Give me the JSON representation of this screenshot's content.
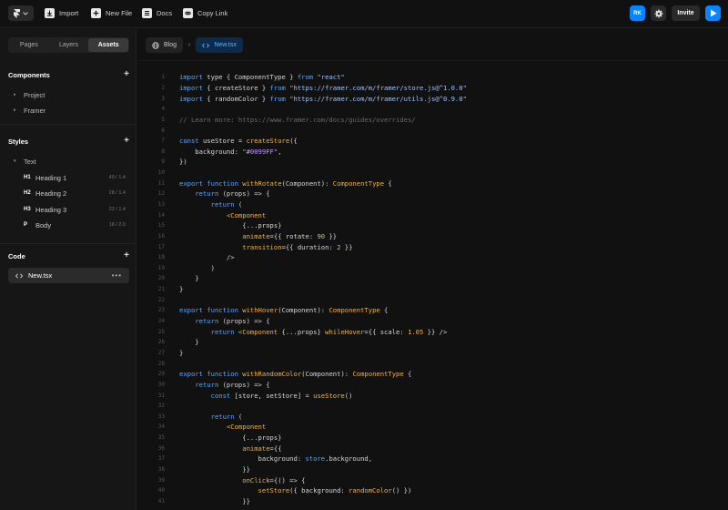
{
  "toolbar": {
    "import_label": "Import",
    "newfile_label": "New File",
    "docs_label": "Docs",
    "copylink_label": "Copy Link",
    "avatar_initials": "RK",
    "invite_label": "Invite"
  },
  "sidebar": {
    "tabs": [
      "Pages",
      "Layers",
      "Assets"
    ],
    "active_tab": "Assets",
    "components_title": "Components",
    "components": [
      "Project",
      "Framer"
    ],
    "styles_title": "Styles",
    "styles_group": "Text",
    "styles": [
      {
        "tag": "H1",
        "name": "Heading 1",
        "meta": "40 / 1.4"
      },
      {
        "tag": "H2",
        "name": "Heading 2",
        "meta": "28 / 1.4"
      },
      {
        "tag": "H3",
        "name": "Heading 3",
        "meta": "22 / 1.4"
      },
      {
        "tag": "P",
        "name": "Body",
        "meta": "18 / 2.0"
      }
    ],
    "code_title": "Code",
    "code_file": "New.tsx"
  },
  "editor": {
    "breadcrumb_root": "Blog",
    "breadcrumb_file": "New.tsx",
    "line_numbers": [
      "1",
      "2",
      "3",
      "4",
      "5",
      "6",
      "7",
      "8",
      "9",
      "10",
      "11",
      "12",
      "13",
      "14",
      "15",
      "16",
      "17",
      "18",
      "19",
      "20",
      "21",
      "22",
      "23",
      "24",
      "25",
      "26",
      "27",
      "28",
      "29",
      "30",
      "31",
      "32",
      "33",
      "34",
      "35",
      "36",
      "37",
      "38",
      "39",
      "40",
      "41"
    ]
  },
  "colors": {
    "accent": "#0a84ff",
    "keyword": "#5aa8ff",
    "function": "#f0b44a",
    "string": "#9ec3ff",
    "comment": "#6a6a6a"
  }
}
